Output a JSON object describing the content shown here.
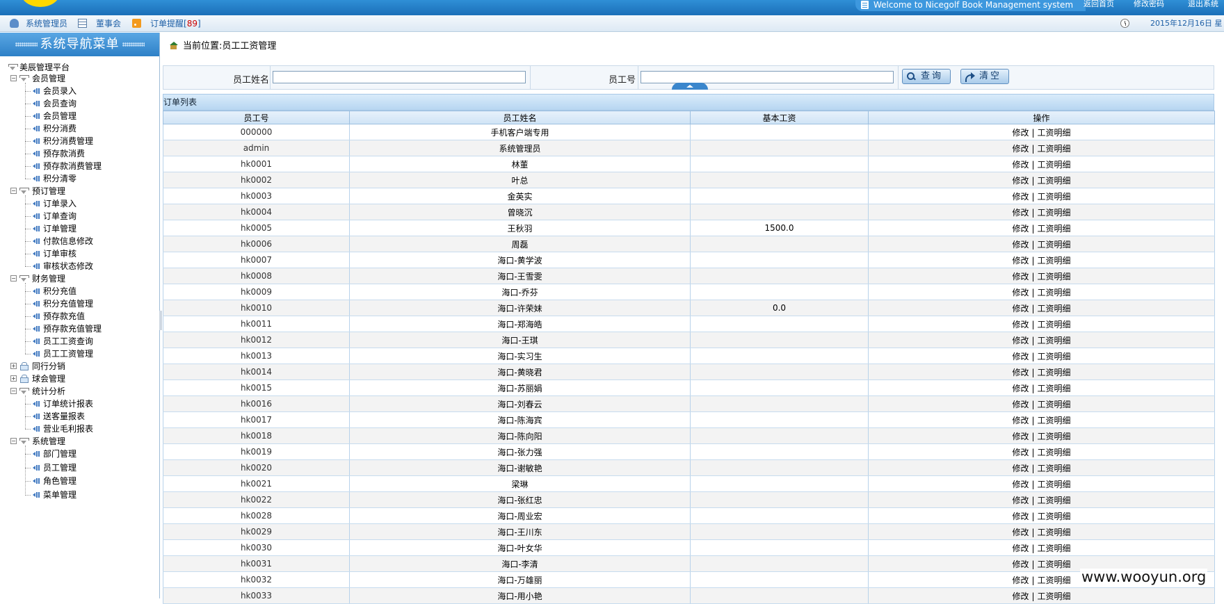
{
  "header": {
    "welcome": "Welcome to Nicegolf Book Management system",
    "links": [
      "返回首页",
      "修改密码",
      "退出系统"
    ]
  },
  "subbar": {
    "user": "系统管理员",
    "board": "董事会",
    "orders_label": "订单提醒",
    "orders_count": "89",
    "date": "2015年12月16日 星"
  },
  "sidebar": {
    "title": "系统导航菜单",
    "root": "美辰管理平台",
    "groups": [
      {
        "label": "会员管理",
        "expanded": true,
        "items": [
          "会员录入",
          "会员查询",
          "会员管理",
          "积分消费",
          "积分消费管理",
          "预存款消费",
          "预存款消费管理",
          "积分清零"
        ]
      },
      {
        "label": "预订管理",
        "expanded": true,
        "items": [
          "订单录入",
          "订单查询",
          "订单管理",
          "付款信息修改",
          "订单审核",
          "审核状态修改"
        ]
      },
      {
        "label": "财务管理",
        "expanded": true,
        "items": [
          "积分充值",
          "积分充值管理",
          "预存款充值",
          "预存款充值管理",
          "员工工资查询",
          "员工工资管理"
        ]
      },
      {
        "label": "同行分销",
        "expanded": false,
        "items": []
      },
      {
        "label": "球会管理",
        "expanded": false,
        "items": []
      },
      {
        "label": "统计分析",
        "expanded": true,
        "items": [
          "订单统计报表",
          "送客量报表",
          "营业毛利报表"
        ]
      },
      {
        "label": "系统管理",
        "expanded": true,
        "items": [
          "部门管理",
          "员工管理",
          "角色管理",
          "菜单管理"
        ]
      }
    ]
  },
  "main": {
    "breadcrumb": "当前位置:员工工资管理",
    "search": {
      "name_label": "员工姓名",
      "name_value": "",
      "id_label": "员工号",
      "id_value": "",
      "query_button": "查询",
      "clear_button": "清空"
    },
    "list_title": "订单列表",
    "columns": [
      "员工号",
      "员工姓名",
      "基本工资",
      "操作"
    ],
    "action_edit": "修改",
    "action_detail": "工资明细",
    "rows": [
      {
        "id": "000000",
        "name": "手机客户端专用",
        "salary": ""
      },
      {
        "id": "admin",
        "name": "系统管理员",
        "salary": ""
      },
      {
        "id": "hk0001",
        "name": "林董",
        "salary": ""
      },
      {
        "id": "hk0002",
        "name": "叶总",
        "salary": ""
      },
      {
        "id": "hk0003",
        "name": "金英实",
        "salary": ""
      },
      {
        "id": "hk0004",
        "name": "曾晓沉",
        "salary": ""
      },
      {
        "id": "hk0005",
        "name": "王秋羽",
        "salary": "1500.0"
      },
      {
        "id": "hk0006",
        "name": "周磊",
        "salary": ""
      },
      {
        "id": "hk0007",
        "name": "海口-黄学波",
        "salary": ""
      },
      {
        "id": "hk0008",
        "name": "海口-王雪雯",
        "salary": ""
      },
      {
        "id": "hk0009",
        "name": "海口-乔芬",
        "salary": ""
      },
      {
        "id": "hk0010",
        "name": "海口-许荣妹",
        "salary": "0.0"
      },
      {
        "id": "hk0011",
        "name": "海口-郑海皓",
        "salary": ""
      },
      {
        "id": "hk0012",
        "name": "海口-王琪",
        "salary": ""
      },
      {
        "id": "hk0013",
        "name": "海口-实习生",
        "salary": ""
      },
      {
        "id": "hk0014",
        "name": "海口-黄晓君",
        "salary": ""
      },
      {
        "id": "hk0015",
        "name": "海口-苏丽娟",
        "salary": ""
      },
      {
        "id": "hk0016",
        "name": "海口-刘春云",
        "salary": ""
      },
      {
        "id": "hk0017",
        "name": "海口-陈海宾",
        "salary": ""
      },
      {
        "id": "hk0018",
        "name": "海口-陈向阳",
        "salary": ""
      },
      {
        "id": "hk0019",
        "name": "海口-张力强",
        "salary": ""
      },
      {
        "id": "hk0020",
        "name": "海口-谢敏艳",
        "salary": ""
      },
      {
        "id": "hk0021",
        "name": "梁琳",
        "salary": ""
      },
      {
        "id": "hk0022",
        "name": "海口-张红忠",
        "salary": ""
      },
      {
        "id": "hk0028",
        "name": "海口-周业宏",
        "salary": ""
      },
      {
        "id": "hk0029",
        "name": "海口-王川东",
        "salary": ""
      },
      {
        "id": "hk0030",
        "name": "海口-叶女华",
        "salary": ""
      },
      {
        "id": "hk0031",
        "name": "海口-李清",
        "salary": ""
      },
      {
        "id": "hk0032",
        "name": "海口-万雄丽",
        "salary": ""
      },
      {
        "id": "hk0033",
        "name": "海口-用小艳",
        "salary": ""
      }
    ]
  },
  "watermark": "www.wooyun.org"
}
